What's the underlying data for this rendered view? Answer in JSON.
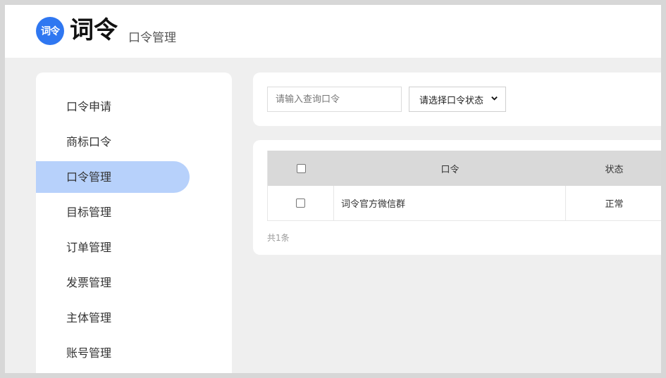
{
  "header": {
    "logo_text": "词令",
    "brand": "词令",
    "subtitle": "口令管理"
  },
  "sidebar": {
    "items": [
      {
        "label": "口令申请",
        "active": false
      },
      {
        "label": "商标口令",
        "active": false
      },
      {
        "label": "口令管理",
        "active": true
      },
      {
        "label": "目标管理",
        "active": false
      },
      {
        "label": "订单管理",
        "active": false
      },
      {
        "label": "发票管理",
        "active": false
      },
      {
        "label": "主体管理",
        "active": false
      },
      {
        "label": "账号管理",
        "active": false
      }
    ]
  },
  "filters": {
    "search_placeholder": "请输入查询口令",
    "search_value": "",
    "status_select": "请选择口令状态"
  },
  "table": {
    "columns": [
      "",
      "口令",
      "状态"
    ],
    "rows": [
      {
        "checked": false,
        "name": "词令官方微信群",
        "status": "正常"
      }
    ],
    "total_text": "共1条"
  },
  "colors": {
    "accent": "#2f77f1",
    "active_nav": "#b7d1fb",
    "header_row": "#d9d9d9",
    "background": "#efefef"
  }
}
